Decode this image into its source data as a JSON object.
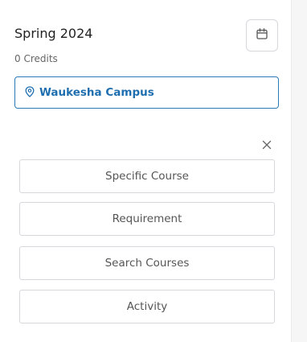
{
  "term": {
    "title": "Spring 2024",
    "credits": "0 Credits"
  },
  "calendar_button": {
    "icon": "calendar-icon"
  },
  "campus": {
    "label": "Waukesha Campus",
    "icon": "map-pin-icon"
  },
  "close": {
    "icon": "close-icon"
  },
  "options": [
    {
      "label": "Specific Course"
    },
    {
      "label": "Requirement"
    },
    {
      "label": "Search Courses"
    },
    {
      "label": "Activity"
    }
  ],
  "colors": {
    "accent": "#1f6fb0",
    "border": "#d7d7dc",
    "text": "#222222",
    "muted": "#666666"
  }
}
